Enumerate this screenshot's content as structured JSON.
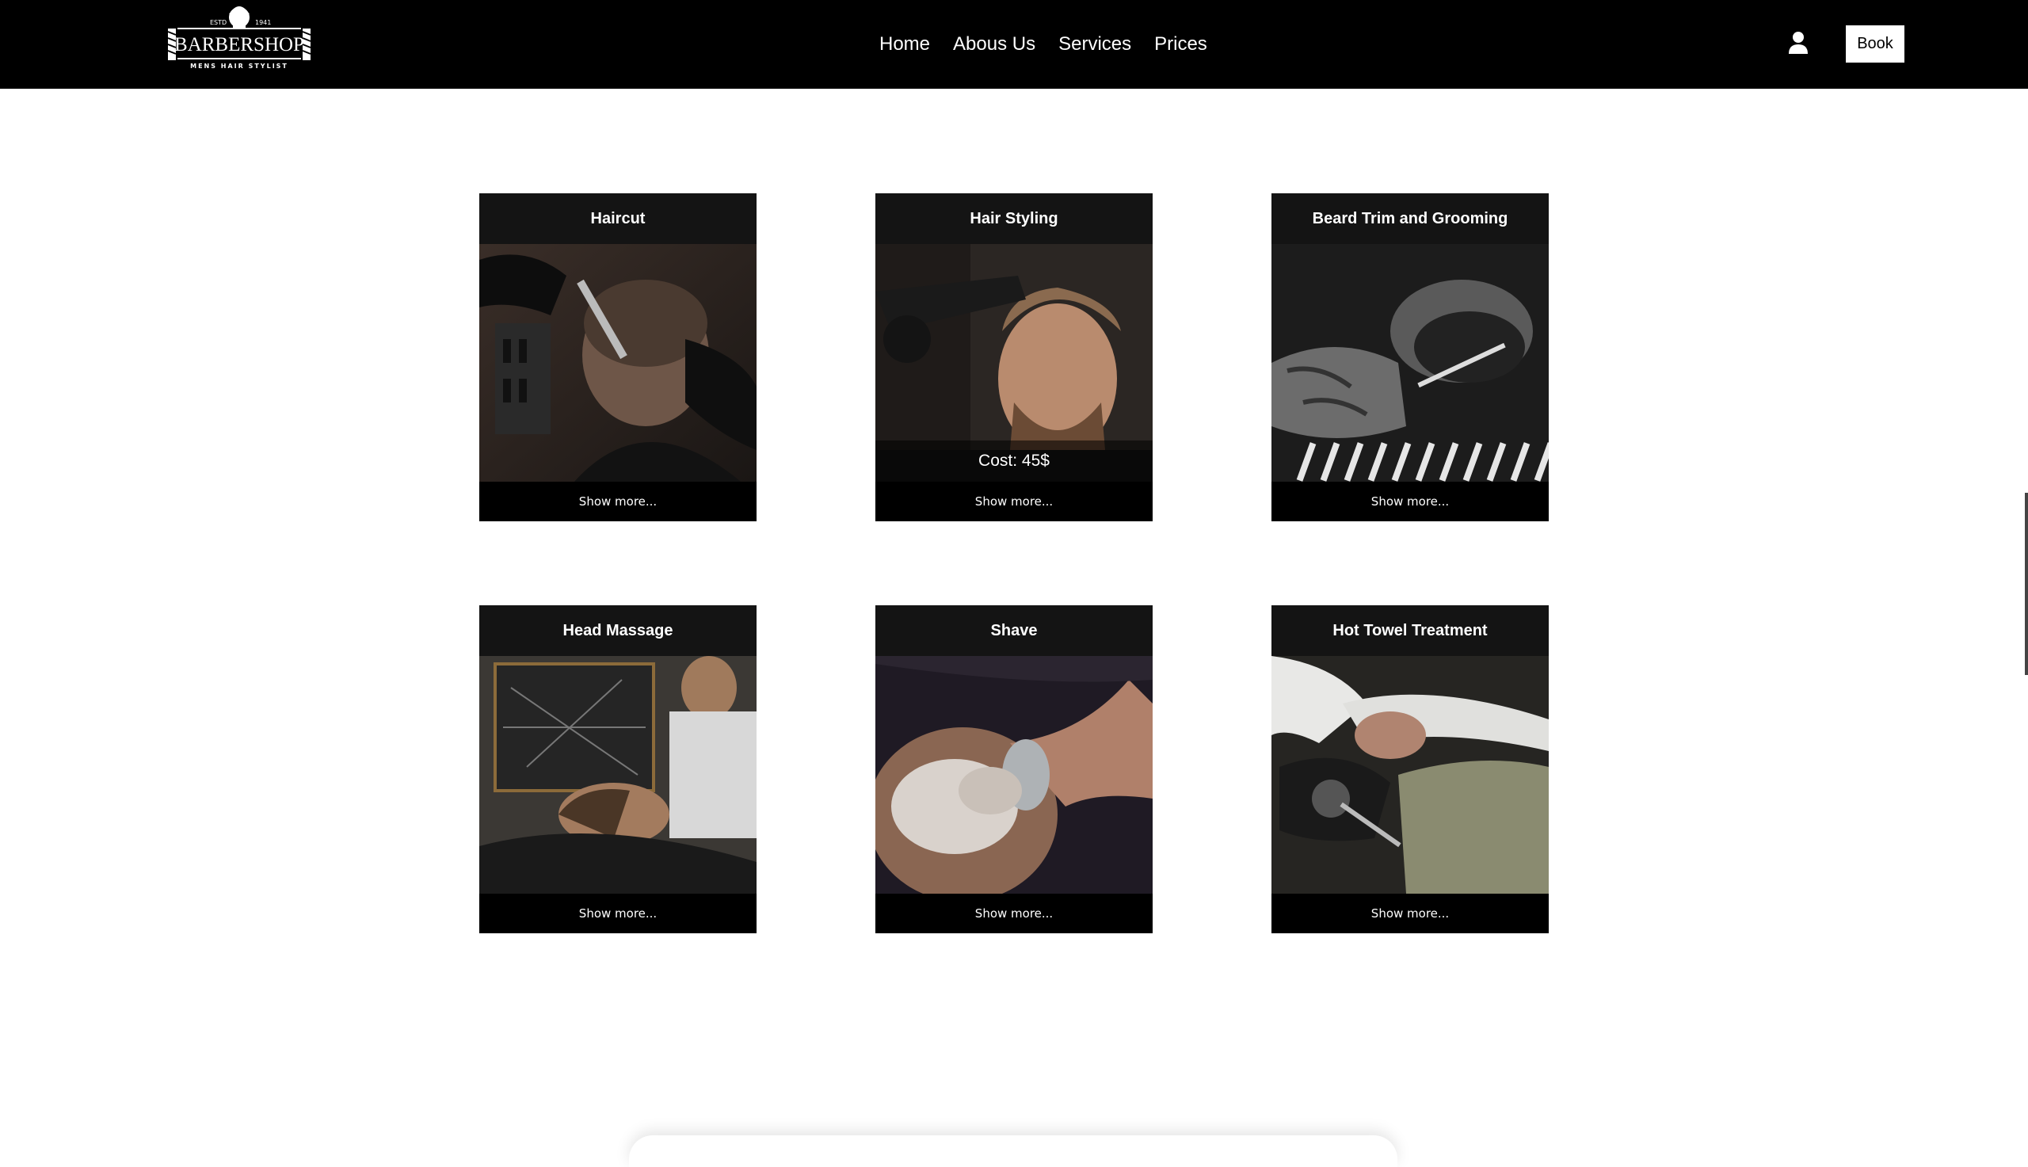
{
  "header": {
    "logo": {
      "estd": "ESTD",
      "year": "1941",
      "name": "BARBERSHOP",
      "tagline": "MENS HAIR STYLIST"
    },
    "nav": [
      "Home",
      "Abous Us",
      "Services",
      "Prices"
    ],
    "book_label": "Book",
    "user_icon": "user-icon"
  },
  "services": [
    {
      "title": "Haircut",
      "show_more": "Show more..."
    },
    {
      "title": "Hair Styling",
      "cost": "Cost: 45$",
      "show_more": "Show more..."
    },
    {
      "title": "Beard Trim and Grooming",
      "show_more": "Show more..."
    },
    {
      "title": "Head Massage",
      "show_more": "Show more..."
    },
    {
      "title": "Shave",
      "show_more": "Show more..."
    },
    {
      "title": "Hot Towel Treatment",
      "show_more": "Show more..."
    }
  ],
  "colors": {
    "header_bg": "#000000",
    "card_bg": "#111111",
    "text": "#ffffff"
  }
}
